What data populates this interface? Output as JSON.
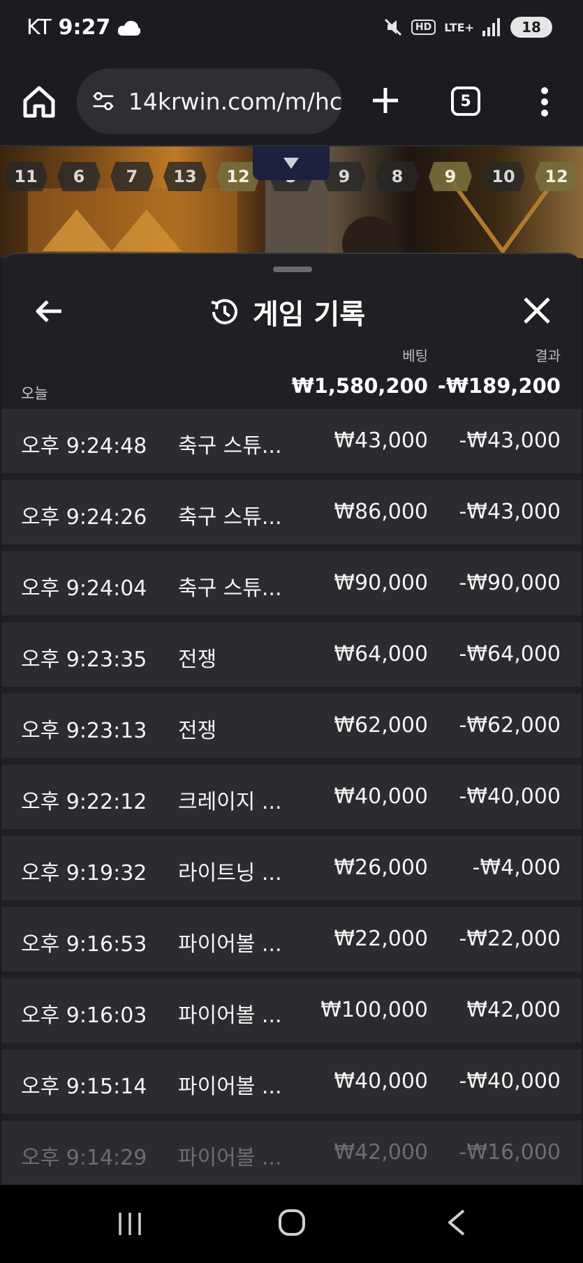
{
  "status_bar": {
    "carrier": "KT",
    "time": "9:27",
    "hd_label": "HD",
    "network_label": "LTE+",
    "battery": "18"
  },
  "browser": {
    "url": "14krwin.com/m/hc",
    "tab_count": "5"
  },
  "roadmap": {
    "chips": [
      "11",
      "6",
      "7",
      "13",
      "12",
      "5",
      "9",
      "8",
      "9",
      "10",
      "12"
    ],
    "highlighted": [
      4,
      8,
      10
    ]
  },
  "panel": {
    "title": "게임 기록",
    "headers": {
      "bet": "베팅",
      "result": "결과"
    },
    "summary": {
      "label": "오늘",
      "bet_total": "₩1,580,200",
      "result_total": "-₩189,200"
    },
    "rows": [
      {
        "time": "오후 9:24:48",
        "game": "축구 스튜...",
        "bet": "₩43,000",
        "result": "-₩43,000"
      },
      {
        "time": "오후 9:24:26",
        "game": "축구 스튜...",
        "bet": "₩86,000",
        "result": "-₩43,000"
      },
      {
        "time": "오후 9:24:04",
        "game": "축구 스튜...",
        "bet": "₩90,000",
        "result": "-₩90,000"
      },
      {
        "time": "오후 9:23:35",
        "game": "전쟁",
        "bet": "₩64,000",
        "result": "-₩64,000"
      },
      {
        "time": "오후 9:23:13",
        "game": "전쟁",
        "bet": "₩62,000",
        "result": "-₩62,000"
      },
      {
        "time": "오후 9:22:12",
        "game": "크레이지 ...",
        "bet": "₩40,000",
        "result": "-₩40,000"
      },
      {
        "time": "오후 9:19:32",
        "game": "라이트닝 ...",
        "bet": "₩26,000",
        "result": "-₩4,000"
      },
      {
        "time": "오후 9:16:53",
        "game": "파이어볼 ...",
        "bet": "₩22,000",
        "result": "-₩22,000"
      },
      {
        "time": "오후 9:16:03",
        "game": "파이어볼 ...",
        "bet": "₩100,000",
        "result": "₩42,000"
      },
      {
        "time": "오후 9:15:14",
        "game": "파이어볼 ...",
        "bet": "₩40,000",
        "result": "-₩40,000"
      },
      {
        "time": "오후 9:14:29",
        "game": "파이어볼 ...",
        "bet": "₩42,000",
        "result": "-₩16,000"
      }
    ]
  },
  "colors": {
    "panel_bg": "#1f2023",
    "row_bg": "#2b2c2f",
    "accent_gold": "#c07a28"
  }
}
